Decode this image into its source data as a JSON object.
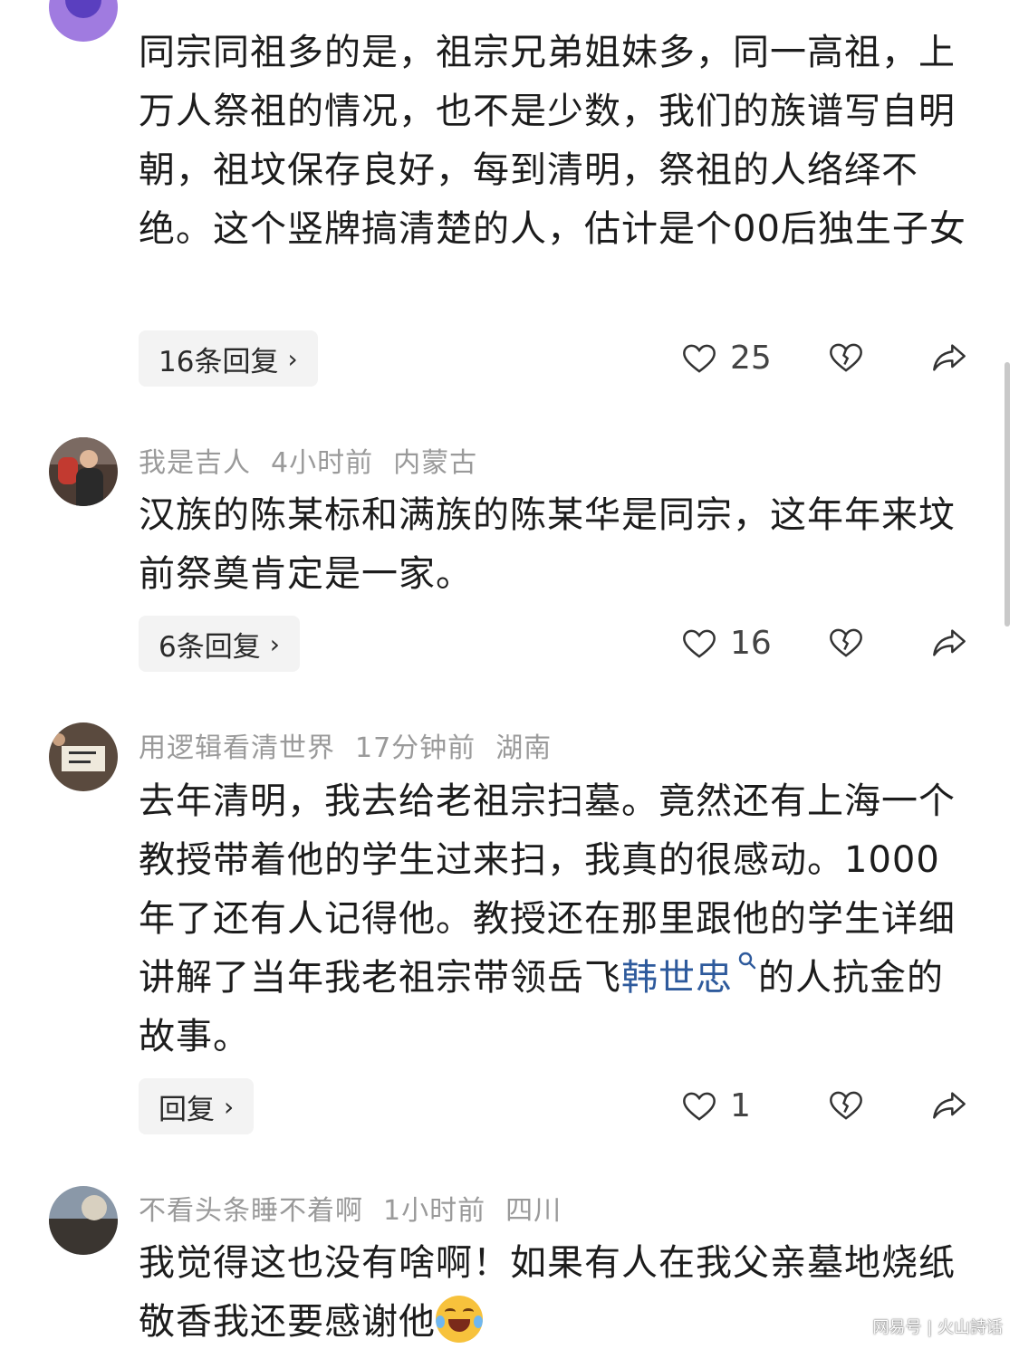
{
  "comments": [
    {
      "body": "同宗同祖多的是，祖宗兄弟姐妹多，同一高祖，上万人祭祖的情况，也不是少数，我们的族谱写自明朝，祖坟保存良好，每到清明，祭祖的人络绎不绝。这个竖牌搞清楚的人，估计是个00后独生子女",
      "reply_label": "16条回复",
      "likes": "25"
    },
    {
      "username": "我是吉人",
      "time": "4小时前",
      "location": "内蒙古",
      "body": "汉族的陈某标和满族的陈某华是同宗，这年年来坟前祭奠肯定是一家。",
      "reply_label": "6条回复",
      "likes": "16"
    },
    {
      "username": "用逻辑看清世界",
      "time": "17分钟前",
      "location": "湖南",
      "body_before_link": "去年清明，我去给老祖宗扫墓。竟然还有上海一个教授带着他的学生过来扫，我真的很感动。1000年了还有人记得他。教授还在那里跟他的学生详细讲解了当年我老祖宗带领岳飞",
      "link_text": "韩世忠",
      "body_after_link": "的人抗金的故事。",
      "reply_label": "回复",
      "likes": "1"
    },
    {
      "username": "不看头条睡不着啊",
      "time": "1小时前",
      "location": "四川",
      "body": "我觉得这也没有啥啊！如果有人在我父亲墓地烧纸敬香我还要感谢他"
    }
  ],
  "watermark": "网易号 | 火山詩话",
  "icons": {
    "like": "heart-outline-icon",
    "dislike": "broken-heart-icon",
    "share": "share-arrow-icon",
    "search": "search-icon",
    "chevron": "chevron-right-icon",
    "emoji": "laugh-cry-emoji"
  },
  "colors": {
    "text": "#1c1c1c",
    "meta": "#9a9a9a",
    "link": "#2e5a9c",
    "reply_bg": "#f3f3f3"
  }
}
